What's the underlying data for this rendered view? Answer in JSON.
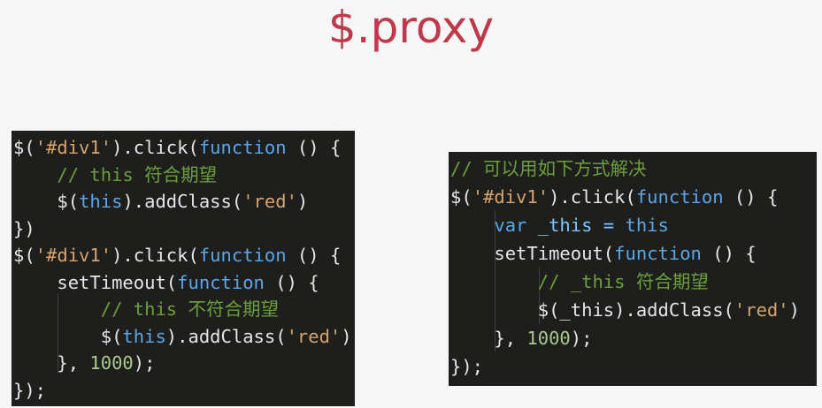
{
  "title": "$.proxy",
  "left_code": [
    [
      [
        "$(",
        "pl"
      ],
      [
        "'#div1'",
        "str"
      ],
      [
        ").click(",
        "pl"
      ],
      [
        "function",
        "kw"
      ],
      [
        " () {",
        "pl"
      ]
    ],
    [
      [
        "    ",
        "pl"
      ],
      [
        "// this 符合期望",
        "cmt"
      ]
    ],
    [
      [
        "    $(",
        "pl"
      ],
      [
        "this",
        "kw"
      ],
      [
        ").addClass(",
        "pl"
      ],
      [
        "'red'",
        "str"
      ],
      [
        ")",
        "pl"
      ]
    ],
    [
      [
        "})",
        "pl"
      ]
    ],
    [
      [
        "$(",
        "pl"
      ],
      [
        "'#div1'",
        "str"
      ],
      [
        ").click(",
        "pl"
      ],
      [
        "function",
        "kw"
      ],
      [
        " () {",
        "pl"
      ]
    ],
    [
      [
        "    setTimeout(",
        "pl"
      ],
      [
        "function",
        "kw"
      ],
      [
        " () {",
        "pl"
      ]
    ],
    [
      [
        "        ",
        "pl"
      ],
      [
        "// this 不符合期望",
        "cmt"
      ]
    ],
    [
      [
        "        $(",
        "pl"
      ],
      [
        "this",
        "kw"
      ],
      [
        ").addClass(",
        "pl"
      ],
      [
        "'red'",
        "str"
      ],
      [
        ")",
        "pl"
      ]
    ],
    [
      [
        "    }, ",
        "pl"
      ],
      [
        "1000",
        "num"
      ],
      [
        ");",
        "pl"
      ]
    ],
    [
      [
        "});",
        "pl"
      ]
    ]
  ],
  "right_code": [
    [
      [
        "// 可以用如下方式解决",
        "cmt"
      ]
    ],
    [
      [
        "$(",
        "pl"
      ],
      [
        "'#div1'",
        "str"
      ],
      [
        ").click(",
        "pl"
      ],
      [
        "function",
        "kw"
      ],
      [
        " () {",
        "pl"
      ]
    ],
    [
      [
        "    ",
        "pl"
      ],
      [
        "var",
        "kw"
      ],
      [
        " _this = ",
        "var"
      ],
      [
        "this",
        "kw"
      ]
    ],
    [
      [
        "    setTimeout(",
        "pl"
      ],
      [
        "function",
        "kw"
      ],
      [
        " () {",
        "pl"
      ]
    ],
    [
      [
        "        ",
        "pl"
      ],
      [
        "// _this 符合期望",
        "cmt"
      ]
    ],
    [
      [
        "        $(_this).addClass(",
        "pl"
      ],
      [
        "'red'",
        "str"
      ],
      [
        ")",
        "pl"
      ]
    ],
    [
      [
        "    }, ",
        "pl"
      ],
      [
        "1000",
        "num"
      ],
      [
        ");",
        "pl"
      ]
    ],
    [
      [
        "});",
        "pl"
      ]
    ]
  ]
}
